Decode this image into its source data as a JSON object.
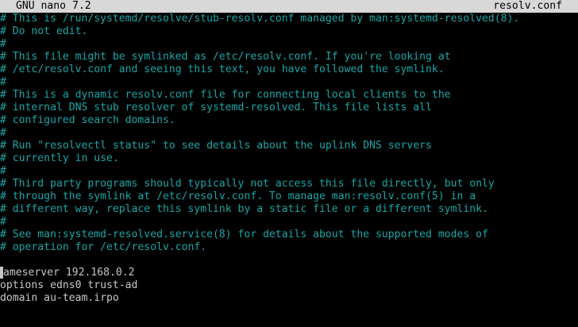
{
  "titlebar": {
    "app": "GNU nano 7.2",
    "file": "resolv.conf"
  },
  "lines": [
    {
      "text": "# This is /run/systemd/resolve/stub-resolv.conf managed by man:systemd-resolved(8).",
      "type": "comment"
    },
    {
      "text": "# Do not edit.",
      "type": "comment"
    },
    {
      "text": "#",
      "type": "comment"
    },
    {
      "text": "# This file might be symlinked as /etc/resolv.conf. If you're looking at",
      "type": "comment"
    },
    {
      "text": "# /etc/resolv.conf and seeing this text, you have followed the symlink.",
      "type": "comment"
    },
    {
      "text": "#",
      "type": "comment"
    },
    {
      "text": "# This is a dynamic resolv.conf file for connecting local clients to the",
      "type": "comment"
    },
    {
      "text": "# internal DNS stub resolver of systemd-resolved. This file lists all",
      "type": "comment"
    },
    {
      "text": "# configured search domains.",
      "type": "comment"
    },
    {
      "text": "#",
      "type": "comment"
    },
    {
      "text": "# Run \"resolvectl status\" to see details about the uplink DNS servers",
      "type": "comment"
    },
    {
      "text": "# currently in use.",
      "type": "comment"
    },
    {
      "text": "#",
      "type": "comment"
    },
    {
      "text": "# Third party programs should typically not access this file directly, but only",
      "type": "comment"
    },
    {
      "text": "# through the symlink at /etc/resolv.conf. To manage man:resolv.conf(5) in a",
      "type": "comment"
    },
    {
      "text": "# different way, replace this symlink by a static file or a different symlink.",
      "type": "comment"
    },
    {
      "text": "#",
      "type": "comment"
    },
    {
      "text": "# See man:systemd-resolved.service(8) for details about the supported modes of",
      "type": "comment"
    },
    {
      "text": "# operation for /etc/resolv.conf.",
      "type": "comment"
    },
    {
      "text": "",
      "type": "plain"
    },
    {
      "text": "nameserver 192.168.0.2",
      "type": "plain"
    },
    {
      "text": "options edns0 trust-ad",
      "type": "plain"
    },
    {
      "text": "domain au-team.irpo",
      "type": "plain"
    }
  ],
  "colors": {
    "background": "#000000",
    "titlebar_bg": "#d8d8d8",
    "comment": "#1aa6a6",
    "plain": "#c8c8c8"
  }
}
